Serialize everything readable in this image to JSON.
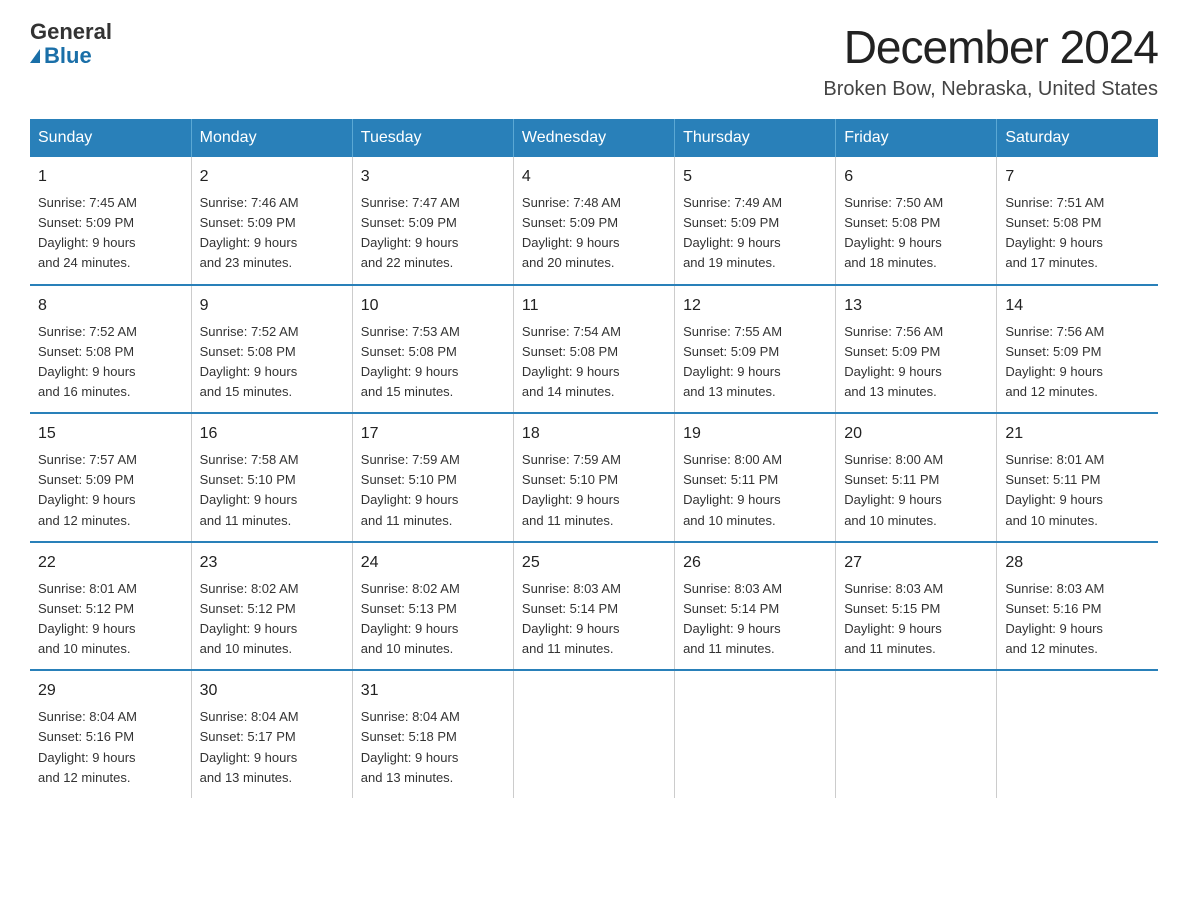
{
  "header": {
    "logo_general": "General",
    "logo_blue": "Blue",
    "title": "December 2024",
    "subtitle": "Broken Bow, Nebraska, United States"
  },
  "days_of_week": [
    "Sunday",
    "Monday",
    "Tuesday",
    "Wednesday",
    "Thursday",
    "Friday",
    "Saturday"
  ],
  "weeks": [
    [
      {
        "num": "1",
        "info": "Sunrise: 7:45 AM\nSunset: 5:09 PM\nDaylight: 9 hours\nand 24 minutes."
      },
      {
        "num": "2",
        "info": "Sunrise: 7:46 AM\nSunset: 5:09 PM\nDaylight: 9 hours\nand 23 minutes."
      },
      {
        "num": "3",
        "info": "Sunrise: 7:47 AM\nSunset: 5:09 PM\nDaylight: 9 hours\nand 22 minutes."
      },
      {
        "num": "4",
        "info": "Sunrise: 7:48 AM\nSunset: 5:09 PM\nDaylight: 9 hours\nand 20 minutes."
      },
      {
        "num": "5",
        "info": "Sunrise: 7:49 AM\nSunset: 5:09 PM\nDaylight: 9 hours\nand 19 minutes."
      },
      {
        "num": "6",
        "info": "Sunrise: 7:50 AM\nSunset: 5:08 PM\nDaylight: 9 hours\nand 18 minutes."
      },
      {
        "num": "7",
        "info": "Sunrise: 7:51 AM\nSunset: 5:08 PM\nDaylight: 9 hours\nand 17 minutes."
      }
    ],
    [
      {
        "num": "8",
        "info": "Sunrise: 7:52 AM\nSunset: 5:08 PM\nDaylight: 9 hours\nand 16 minutes."
      },
      {
        "num": "9",
        "info": "Sunrise: 7:52 AM\nSunset: 5:08 PM\nDaylight: 9 hours\nand 15 minutes."
      },
      {
        "num": "10",
        "info": "Sunrise: 7:53 AM\nSunset: 5:08 PM\nDaylight: 9 hours\nand 15 minutes."
      },
      {
        "num": "11",
        "info": "Sunrise: 7:54 AM\nSunset: 5:08 PM\nDaylight: 9 hours\nand 14 minutes."
      },
      {
        "num": "12",
        "info": "Sunrise: 7:55 AM\nSunset: 5:09 PM\nDaylight: 9 hours\nand 13 minutes."
      },
      {
        "num": "13",
        "info": "Sunrise: 7:56 AM\nSunset: 5:09 PM\nDaylight: 9 hours\nand 13 minutes."
      },
      {
        "num": "14",
        "info": "Sunrise: 7:56 AM\nSunset: 5:09 PM\nDaylight: 9 hours\nand 12 minutes."
      }
    ],
    [
      {
        "num": "15",
        "info": "Sunrise: 7:57 AM\nSunset: 5:09 PM\nDaylight: 9 hours\nand 12 minutes."
      },
      {
        "num": "16",
        "info": "Sunrise: 7:58 AM\nSunset: 5:10 PM\nDaylight: 9 hours\nand 11 minutes."
      },
      {
        "num": "17",
        "info": "Sunrise: 7:59 AM\nSunset: 5:10 PM\nDaylight: 9 hours\nand 11 minutes."
      },
      {
        "num": "18",
        "info": "Sunrise: 7:59 AM\nSunset: 5:10 PM\nDaylight: 9 hours\nand 11 minutes."
      },
      {
        "num": "19",
        "info": "Sunrise: 8:00 AM\nSunset: 5:11 PM\nDaylight: 9 hours\nand 10 minutes."
      },
      {
        "num": "20",
        "info": "Sunrise: 8:00 AM\nSunset: 5:11 PM\nDaylight: 9 hours\nand 10 minutes."
      },
      {
        "num": "21",
        "info": "Sunrise: 8:01 AM\nSunset: 5:11 PM\nDaylight: 9 hours\nand 10 minutes."
      }
    ],
    [
      {
        "num": "22",
        "info": "Sunrise: 8:01 AM\nSunset: 5:12 PM\nDaylight: 9 hours\nand 10 minutes."
      },
      {
        "num": "23",
        "info": "Sunrise: 8:02 AM\nSunset: 5:12 PM\nDaylight: 9 hours\nand 10 minutes."
      },
      {
        "num": "24",
        "info": "Sunrise: 8:02 AM\nSunset: 5:13 PM\nDaylight: 9 hours\nand 10 minutes."
      },
      {
        "num": "25",
        "info": "Sunrise: 8:03 AM\nSunset: 5:14 PM\nDaylight: 9 hours\nand 11 minutes."
      },
      {
        "num": "26",
        "info": "Sunrise: 8:03 AM\nSunset: 5:14 PM\nDaylight: 9 hours\nand 11 minutes."
      },
      {
        "num": "27",
        "info": "Sunrise: 8:03 AM\nSunset: 5:15 PM\nDaylight: 9 hours\nand 11 minutes."
      },
      {
        "num": "28",
        "info": "Sunrise: 8:03 AM\nSunset: 5:16 PM\nDaylight: 9 hours\nand 12 minutes."
      }
    ],
    [
      {
        "num": "29",
        "info": "Sunrise: 8:04 AM\nSunset: 5:16 PM\nDaylight: 9 hours\nand 12 minutes."
      },
      {
        "num": "30",
        "info": "Sunrise: 8:04 AM\nSunset: 5:17 PM\nDaylight: 9 hours\nand 13 minutes."
      },
      {
        "num": "31",
        "info": "Sunrise: 8:04 AM\nSunset: 5:18 PM\nDaylight: 9 hours\nand 13 minutes."
      },
      {
        "num": "",
        "info": ""
      },
      {
        "num": "",
        "info": ""
      },
      {
        "num": "",
        "info": ""
      },
      {
        "num": "",
        "info": ""
      }
    ]
  ]
}
